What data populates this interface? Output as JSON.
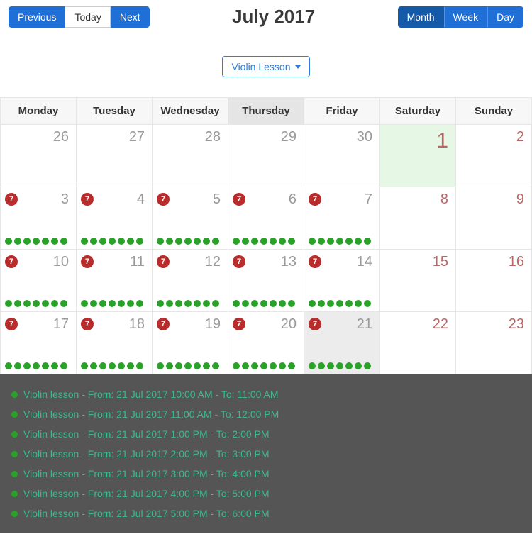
{
  "toolbar": {
    "previous": "Previous",
    "today": "Today",
    "next": "Next",
    "title": "July 2017",
    "view_month": "Month",
    "view_week": "Week",
    "view_day": "Day",
    "active_view": "Month"
  },
  "filter": {
    "label": "Violin Lesson"
  },
  "days": [
    "Monday",
    "Tuesday",
    "Wednesday",
    "Thursday",
    "Friday",
    "Saturday",
    "Sunday"
  ],
  "today_day_index": 3,
  "grid": [
    [
      {
        "n": "26",
        "other": true
      },
      {
        "n": "27",
        "other": true
      },
      {
        "n": "28",
        "other": true
      },
      {
        "n": "29",
        "other": true
      },
      {
        "n": "30",
        "other": true
      },
      {
        "n": "1",
        "weekend": true,
        "highlight": true,
        "big": true
      },
      {
        "n": "2",
        "weekend": true
      }
    ],
    [
      {
        "n": "3",
        "badge": "7",
        "dots": 7
      },
      {
        "n": "4",
        "badge": "7",
        "dots": 7
      },
      {
        "n": "5",
        "badge": "7",
        "dots": 7
      },
      {
        "n": "6",
        "badge": "7",
        "dots": 7
      },
      {
        "n": "7",
        "badge": "7",
        "dots": 7
      },
      {
        "n": "8",
        "weekend": true
      },
      {
        "n": "9",
        "weekend": true
      }
    ],
    [
      {
        "n": "10",
        "badge": "7",
        "dots": 7
      },
      {
        "n": "11",
        "badge": "7",
        "dots": 7
      },
      {
        "n": "12",
        "badge": "7",
        "dots": 7
      },
      {
        "n": "13",
        "badge": "7",
        "dots": 7
      },
      {
        "n": "14",
        "badge": "7",
        "dots": 7
      },
      {
        "n": "15",
        "weekend": true
      },
      {
        "n": "16",
        "weekend": true
      }
    ],
    [
      {
        "n": "17",
        "badge": "7",
        "dots": 7
      },
      {
        "n": "18",
        "badge": "7",
        "dots": 7
      },
      {
        "n": "19",
        "badge": "7",
        "dots": 7
      },
      {
        "n": "20",
        "badge": "7",
        "dots": 7
      },
      {
        "n": "21",
        "badge": "7",
        "dots": 7,
        "selected": true
      },
      {
        "n": "22",
        "weekend": true
      },
      {
        "n": "23",
        "weekend": true
      }
    ]
  ],
  "events": [
    "Violin lesson - From: 21 Jul 2017 10:00 AM - To: 11:00 AM",
    "Violin lesson - From: 21 Jul 2017 11:00 AM - To: 12:00 PM",
    "Violin lesson - From: 21 Jul 2017 1:00 PM - To: 2:00 PM",
    "Violin lesson - From: 21 Jul 2017 2:00 PM - To: 3:00 PM",
    "Violin lesson - From: 21 Jul 2017 3:00 PM - To: 4:00 PM",
    "Violin lesson - From: 21 Jul 2017 4:00 PM - To: 5:00 PM",
    "Violin lesson - From: 21 Jul 2017 5:00 PM - To: 6:00 PM"
  ]
}
